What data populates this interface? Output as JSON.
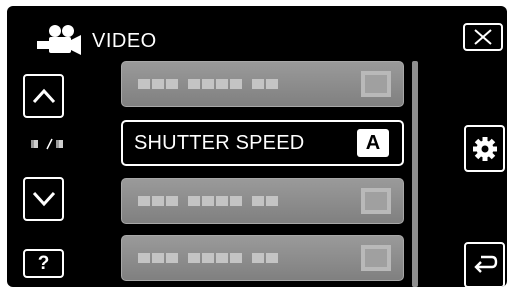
{
  "header": {
    "mode_icon": "video-camera-icon",
    "title": "VIDEO",
    "close_icon": "close-icon"
  },
  "nav": {
    "up_icon": "chevron-up-icon",
    "down_icon": "chevron-down-icon",
    "page_indicator": "■/■",
    "help_label": "?"
  },
  "menu": {
    "items": [
      {
        "label": "",
        "placeholder": true
      },
      {
        "label": "SHUTTER SPEED",
        "value": "A",
        "selected": true
      },
      {
        "label": "",
        "placeholder": true
      },
      {
        "label": "",
        "placeholder": true
      }
    ]
  },
  "side": {
    "settings_icon": "gear-icon",
    "back_icon": "return-arrow-icon"
  },
  "colors": {
    "background": "#000000",
    "item_gray": "#8e8e8e",
    "text": "#ffffff"
  }
}
